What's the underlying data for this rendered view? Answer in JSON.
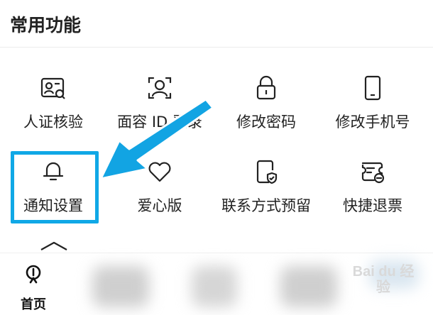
{
  "section": {
    "title": "常用功能"
  },
  "grid": [
    {
      "label": "人证核验",
      "icon": "id-verify-icon"
    },
    {
      "label": "面容 ID 登录",
      "icon": "face-id-icon"
    },
    {
      "label": "修改密码",
      "icon": "lock-icon"
    },
    {
      "label": "修改手机号",
      "icon": "phone-icon"
    },
    {
      "label": "通知设置",
      "icon": "bell-icon"
    },
    {
      "label": "爱心版",
      "icon": "heart-icon"
    },
    {
      "label": "联系方式预留",
      "icon": "contact-shield-icon"
    },
    {
      "label": "快捷退票",
      "icon": "ticket-refund-icon"
    }
  ],
  "tabbar": {
    "home_label": "首页",
    "home_icon": "home-icon"
  },
  "watermark": {
    "text": "Bai du 经验"
  },
  "colors": {
    "highlight": "#10a8e6",
    "text": "#222222"
  }
}
